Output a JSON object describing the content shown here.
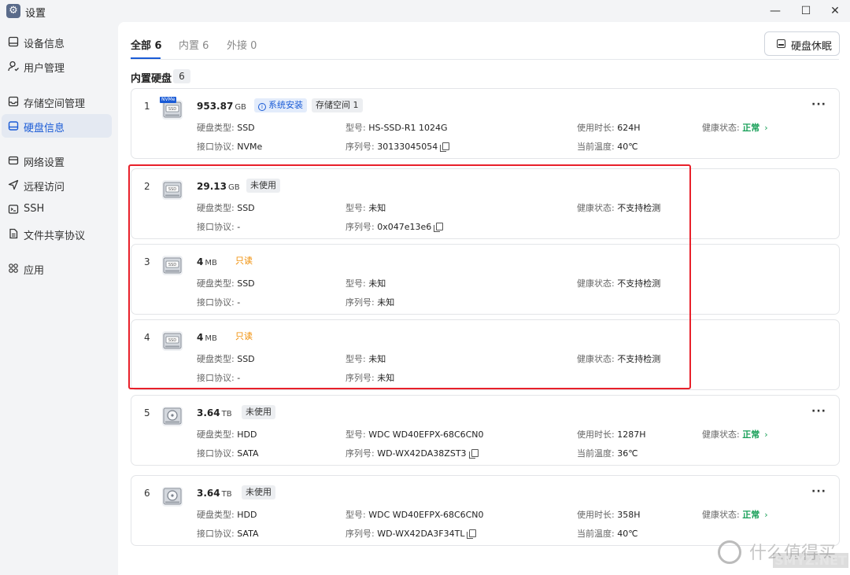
{
  "window": {
    "title": "设置",
    "icon": "gear-icon"
  },
  "sidebar": {
    "items": [
      {
        "label": "设备信息",
        "icon": "device-icon"
      },
      {
        "label": "用户管理",
        "icon": "user-icon"
      },
      {
        "label": "存储空间管理",
        "icon": "storage-icon"
      },
      {
        "label": "硬盘信息",
        "icon": "disk-icon",
        "active": true
      },
      {
        "label": "网络设置",
        "icon": "network-icon"
      },
      {
        "label": "远程访问",
        "icon": "send-icon"
      },
      {
        "label": "SSH",
        "icon": "terminal-icon"
      },
      {
        "label": "文件共享协议",
        "icon": "file-icon"
      },
      {
        "label": "应用",
        "icon": "apps-icon"
      }
    ]
  },
  "tabs": [
    {
      "label": "全部 6",
      "active": true
    },
    {
      "label": "内置 6"
    },
    {
      "label": "外接 0"
    }
  ],
  "toolbar": {
    "sleep_label": "硬盘休眠"
  },
  "section": {
    "title": "内置硬盘",
    "count": "6"
  },
  "labels": {
    "type": "硬盘类型:",
    "interface": "接口协议:",
    "model": "型号:",
    "serial": "序列号:",
    "usage": "使用时长:",
    "temp": "当前温度:",
    "health": "健康状态:",
    "more": "···"
  },
  "disks": [
    {
      "index": "1",
      "size": "953.87",
      "unit": "GB",
      "kind": "nvme",
      "badge": "NVMe",
      "tags": [
        {
          "text": "系统安装",
          "style": "blue"
        },
        {
          "text": "存储空间 1",
          "style": "gray"
        }
      ],
      "type": "SSD",
      "interface": "NVMe",
      "model": "HS-SSD-R1 1024G",
      "serial": "30133045054",
      "usage": "624H",
      "temp": "40℃",
      "health": "正常"
    },
    {
      "index": "2",
      "size": "29.13",
      "unit": "GB",
      "kind": "ssd",
      "tags": [
        {
          "text": "未使用",
          "style": "gray"
        }
      ],
      "type": "SSD",
      "interface": "-",
      "model": "未知",
      "serial": "0x047e13e6",
      "health": "不支持检测"
    },
    {
      "index": "3",
      "size": "4",
      "unit": "MB",
      "kind": "ssd",
      "tags": [
        {
          "text": "只读",
          "style": "orange"
        }
      ],
      "type": "SSD",
      "interface": "-",
      "model": "未知",
      "serial": "未知",
      "health": "不支持检测"
    },
    {
      "index": "4",
      "size": "4",
      "unit": "MB",
      "kind": "ssd",
      "tags": [
        {
          "text": "只读",
          "style": "orange"
        }
      ],
      "type": "SSD",
      "interface": "-",
      "model": "未知",
      "serial": "未知",
      "health": "不支持检测"
    },
    {
      "index": "5",
      "size": "3.64",
      "unit": "TB",
      "kind": "hdd",
      "tags": [
        {
          "text": "未使用",
          "style": "gray"
        }
      ],
      "type": "HDD",
      "interface": "SATA",
      "model": "WDC WD40EFPX-68C6CN0",
      "serial": "WD-WX42DA38ZST3",
      "usage": "1287H",
      "temp": "36℃",
      "health": "正常"
    },
    {
      "index": "6",
      "size": "3.64",
      "unit": "TB",
      "kind": "hdd",
      "tags": [
        {
          "text": "未使用",
          "style": "gray"
        }
      ],
      "type": "HDD",
      "interface": "SATA",
      "model": "WDC WD40EFPX-68C6CN0",
      "serial": "WD-WX42DA3F34TL",
      "usage": "358H",
      "temp": "40℃",
      "health": "正常"
    }
  ],
  "watermark": {
    "cn": "什么值得买",
    "en": "SMYZ.NET"
  },
  "colors": {
    "accent": "#1a5bd6",
    "ok": "#18a058",
    "readonly": "#f08c00",
    "highlight": "#e8202a"
  }
}
